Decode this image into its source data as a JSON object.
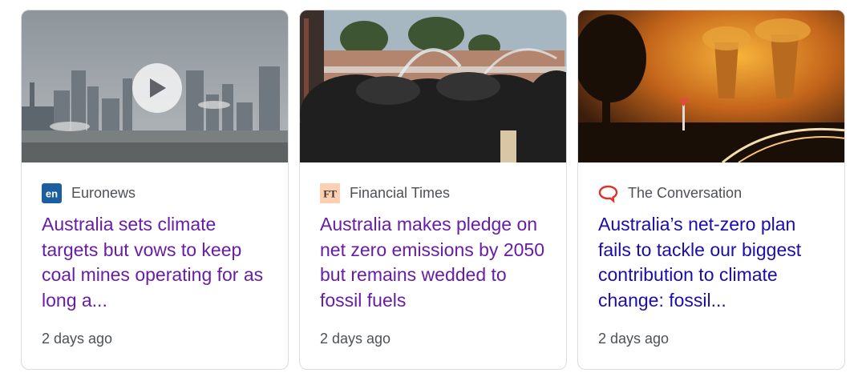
{
  "cards": [
    {
      "source": "Euronews",
      "logo_icon": "euronews-logo-icon",
      "logo_text": "en",
      "headline": "Australia sets climate targets but vows to keep coal mines operating for as long a...",
      "time": "2 days ago",
      "has_video": true
    },
    {
      "source": "Financial Times",
      "logo_icon": "ft-logo-icon",
      "logo_text": "FT",
      "headline": "Australia makes pledge on net zero emissions by 2050 but remains wedded to fossil fuels",
      "time": "2 days ago",
      "has_video": false
    },
    {
      "source": "The Conversation",
      "logo_icon": "speech-bubble-icon",
      "logo_text": "",
      "headline": "Australia’s net-zero plan fails to tackle our biggest contribution to climate change: fossil...",
      "time": "2 days ago",
      "has_video": false
    }
  ],
  "colors": {
    "headline_visited": "#681da8",
    "headline_unvisited": "#1a0dab",
    "meta_text": "#4d5156",
    "euronews_blue": "#1b5fa0",
    "ft_bg": "#fcd0b1",
    "conversation_red": "#d8352a"
  }
}
